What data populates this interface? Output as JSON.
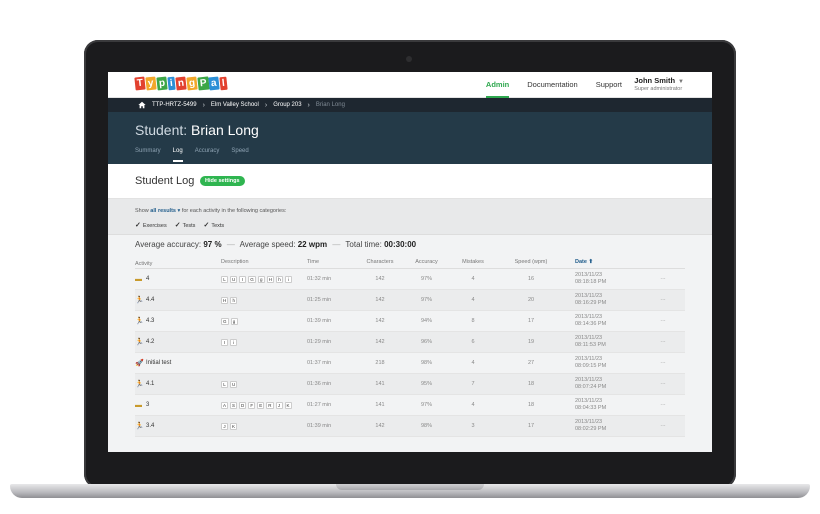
{
  "app": {
    "logo_letters": [
      "T",
      "y",
      "p",
      "i",
      "n",
      "g",
      "P",
      "a",
      "l"
    ],
    "logo_colors": [
      "#e2412f",
      "#f2a72a",
      "#3ca646",
      "#2c8fd6",
      "#e2412f",
      "#f2a72a",
      "#3ca646",
      "#2c8fd6",
      "#e2412f"
    ]
  },
  "nav": {
    "links": [
      "Admin",
      "Documentation",
      "Support"
    ],
    "user_name": "John Smith",
    "user_role": "Super administrator"
  },
  "breadcrumb": {
    "items": [
      "TTP-HRTZ-5499",
      "Elm Valley School",
      "Group 203",
      "Brian Long"
    ]
  },
  "student": {
    "prefix": "Student:",
    "name": "Brian Long",
    "tabs": [
      "Summary",
      "Log",
      "Accuracy",
      "Speed"
    ]
  },
  "log": {
    "title": "Student Log",
    "hide_settings": "Hide settings",
    "show_prefix": "Show",
    "show_value": "all results",
    "show_suffix": "for each activity in the following categories:",
    "categories": [
      "Exercises",
      "Tests",
      "Texts"
    ]
  },
  "summary": {
    "accuracy_label": "Average accuracy:",
    "accuracy_value": "97 %",
    "speed_label": "Average speed:",
    "speed_value": "22 wpm",
    "time_label": "Total time:",
    "time_value": "00:30:00"
  },
  "table": {
    "headers": {
      "activity": "Activity",
      "description": "Description",
      "time": "Time",
      "characters": "Characters",
      "accuracy": "Accuracy",
      "mistakes": "Mistakes",
      "speed": "Speed (wpm)",
      "date": "Date ⬆"
    },
    "rows": [
      {
        "icon": "keyboard-icon",
        "activity": "4",
        "keys": [
          "L",
          "U",
          "I",
          "G",
          "g",
          "H",
          "h",
          "i"
        ],
        "time": "01:32 min",
        "chars": "142",
        "acc": "97%",
        "mist": "4",
        "speed": "16",
        "date": "2013/11/23",
        "clock": "08:18:18 PM",
        "more": "···"
      },
      {
        "icon": "runner-icon",
        "activity": "4.4",
        "keys": [
          "H",
          "h"
        ],
        "time": "01:25 min",
        "chars": "142",
        "acc": "97%",
        "mist": "4",
        "speed": "20",
        "date": "2013/11/23",
        "clock": "08:16:29 PM",
        "more": "···"
      },
      {
        "icon": "runner-icon",
        "activity": "4.3",
        "keys": [
          "G",
          "g"
        ],
        "time": "01:39 min",
        "chars": "142",
        "acc": "94%",
        "mist": "8",
        "speed": "17",
        "date": "2013/11/23",
        "clock": "08:14:36 PM",
        "more": "···"
      },
      {
        "icon": "runner-icon",
        "activity": "4.2",
        "keys": [
          "I",
          "i"
        ],
        "time": "01:29 min",
        "chars": "142",
        "acc": "96%",
        "mist": "6",
        "speed": "19",
        "date": "2013/11/23",
        "clock": "08:11:53 PM",
        "more": "···"
      },
      {
        "icon": "rocket-icon",
        "activity": "Initial test",
        "keys": [],
        "time": "01:37 min",
        "chars": "218",
        "acc": "98%",
        "mist": "4",
        "speed": "27",
        "date": "2013/11/23",
        "clock": "08:09:15 PM",
        "more": "···"
      },
      {
        "icon": "runner-icon",
        "activity": "4.1",
        "keys": [
          "L",
          "U"
        ],
        "time": "01:36 min",
        "chars": "141",
        "acc": "95%",
        "mist": "7",
        "speed": "18",
        "date": "2013/11/23",
        "clock": "08:07:24 PM",
        "more": "···"
      },
      {
        "icon": "keyboard-icon",
        "activity": "3",
        "keys": [
          "A",
          "S",
          "D",
          "F",
          "E",
          "R",
          "J",
          "K"
        ],
        "time": "01:27 min",
        "chars": "141",
        "acc": "97%",
        "mist": "4",
        "speed": "18",
        "date": "2013/11/23",
        "clock": "08:04:33 PM",
        "more": "···"
      },
      {
        "icon": "runner-icon",
        "activity": "3.4",
        "keys": [
          "J",
          "K"
        ],
        "time": "01:39 min",
        "chars": "142",
        "acc": "98%",
        "mist": "3",
        "speed": "17",
        "date": "2013/11/23",
        "clock": "08:02:29 PM",
        "more": "···"
      }
    ]
  }
}
